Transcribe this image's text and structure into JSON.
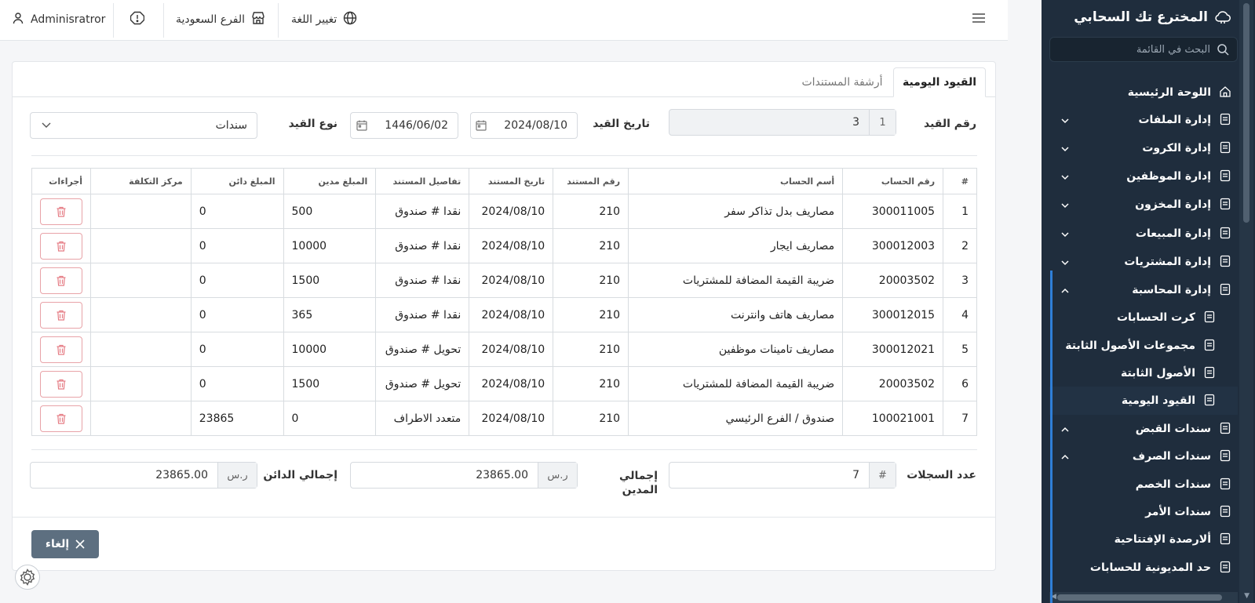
{
  "sidebar": {
    "brand": "المخترع تك السحابي",
    "search_placeholder": "البحث في القائمة",
    "items": [
      {
        "label": "اللوحة الرئيسية",
        "icon": "home-icon"
      },
      {
        "label": "إدارة الملفات",
        "icon": "file-icon"
      },
      {
        "label": "إدارة الكروت",
        "icon": "tag-icon"
      },
      {
        "label": "إدارة الموظفين",
        "icon": "fingerprint-icon"
      },
      {
        "label": "إدارة المخزون",
        "icon": "box-icon"
      },
      {
        "label": "إدارة المبيعات",
        "icon": "cart-icon"
      },
      {
        "label": "إدارة المشتريات",
        "icon": "basket-icon"
      },
      {
        "label": "إدارة المحاسبة",
        "icon": "coin-icon"
      },
      {
        "label": "كرت الحسابات",
        "icon": "sliders-icon"
      },
      {
        "label": "مجموعات الأصول الثابتة",
        "icon": "nodes-icon"
      },
      {
        "label": "الأصول الثابتة",
        "icon": "doc-icon"
      },
      {
        "label": "القيود اليومية",
        "icon": "books-icon"
      },
      {
        "label": "سندات القبض",
        "icon": "receipt-icon"
      },
      {
        "label": "سندات الصرف",
        "icon": "receipt-icon"
      },
      {
        "label": "سندات الخصم",
        "icon": "receipt-icon"
      },
      {
        "label": "سندات الأمر",
        "icon": "receipt-icon"
      },
      {
        "label": "ألارصدة الإفتتاحية",
        "icon": "receipt-icon"
      },
      {
        "label": "حد المديونية للحسابات",
        "icon": "file-icon"
      }
    ]
  },
  "topbar": {
    "language": "تغيير اللغة",
    "branch": "الفرع السعودية",
    "user": "Adminisratror"
  },
  "tabs": {
    "daily_entries": "القيود اليومية",
    "doc_archive": "أرشفة المستندات"
  },
  "form": {
    "entry_no_label": "رقم القيد",
    "entry_no": "3",
    "entry_no_addon": "1",
    "entry_date_label": "تاريخ القيد",
    "entry_date": "2024/08/10",
    "hijri_date": "1446/06/02",
    "entry_type_label": "نوع القيد",
    "entry_type": "سندات"
  },
  "table": {
    "headers": [
      "#",
      "رقم الحساب",
      "أسم الحساب",
      "رقم المستند",
      "تاريخ المستند",
      "تفاصيل المستند",
      "المبلغ مدين",
      "المبلغ دائن",
      "مركز التكلفة",
      "أجراءات"
    ],
    "rows": [
      [
        "1",
        "300011005",
        "مصاريف بدل تذاكر سفر",
        "210",
        "2024/08/10",
        "نقدا # صندوق",
        "500",
        "0",
        ""
      ],
      [
        "2",
        "300012003",
        "مصاريف ايجار",
        "210",
        "2024/08/10",
        "نقدا # صندوق",
        "10000",
        "0",
        ""
      ],
      [
        "3",
        "20003502",
        "ضريبة القيمة المضافة للمشتريات",
        "210",
        "2024/08/10",
        "نقدا # صندوق",
        "1500",
        "0",
        ""
      ],
      [
        "4",
        "300012015",
        "مصاريف هاتف وانترنت",
        "210",
        "2024/08/10",
        "نقدا # صندوق",
        "365",
        "0",
        ""
      ],
      [
        "5",
        "300012021",
        "مصاريف تامينات موظفين",
        "210",
        "2024/08/10",
        "تحويل # صندوق",
        "10000",
        "0",
        ""
      ],
      [
        "6",
        "20003502",
        "ضريبة القيمة المضافة للمشتريات",
        "210",
        "2024/08/10",
        "تحويل # صندوق",
        "1500",
        "0",
        ""
      ],
      [
        "7",
        "100021001",
        "صندوق / الفرع الرئيسي",
        "210",
        "2024/08/10",
        "متعدد الاطراف",
        "0",
        "23865",
        ""
      ]
    ]
  },
  "summary": {
    "records_label": "عدد السجلات",
    "records": "7",
    "records_addon": "#",
    "debit_label": "إجمالي المدين",
    "debit": "23865.00",
    "credit_label": "إجمالي الدائن",
    "credit": "23865.00",
    "currency": "ر.س"
  },
  "cancel_label": "إلغاء"
}
